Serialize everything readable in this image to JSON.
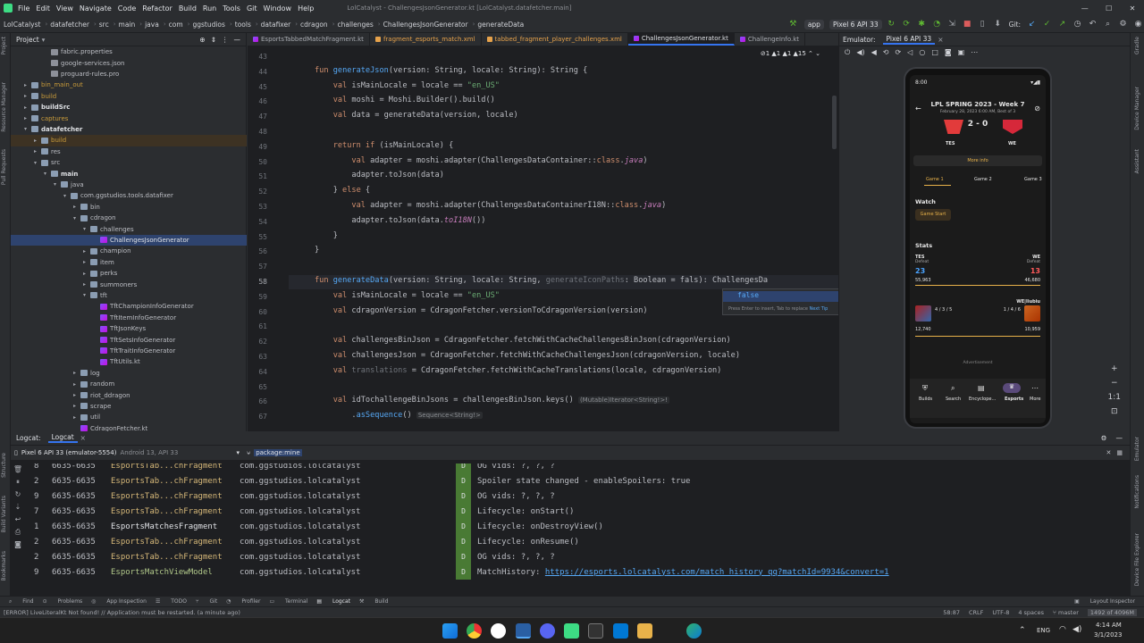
{
  "menu": [
    "File",
    "Edit",
    "View",
    "Navigate",
    "Code",
    "Refactor",
    "Build",
    "Run",
    "Tools",
    "Git",
    "Window",
    "Help"
  ],
  "window_title": "LolCatalyst - ChallengesJsonGenerator.kt [LolCatalyst.datafetcher.main]",
  "breadcrumbs": [
    "LolCatalyst",
    "datafetcher",
    "src",
    "main",
    "java",
    "com",
    "ggstudios",
    "tools",
    "datafixer",
    "cdragon",
    "challenges",
    "ChallengesJsonGenerator",
    "generateData"
  ],
  "toolbar": {
    "run_config": "app",
    "device": "Pixel 6 API 33",
    "git_label": "Git:"
  },
  "project": {
    "title": "Project",
    "rows": [
      {
        "label": "fabric.properties",
        "indent": 3,
        "type": "file",
        "state": ""
      },
      {
        "label": "google-services.json",
        "indent": 3,
        "type": "file",
        "state": ""
      },
      {
        "label": "proguard-rules.pro",
        "indent": 3,
        "type": "file",
        "state": ""
      },
      {
        "label": "bin_main_out",
        "indent": 1,
        "type": "folder",
        "state": "excluded",
        "arrow": "▸"
      },
      {
        "label": "build",
        "indent": 1,
        "type": "folder",
        "state": "excluded",
        "arrow": "▸"
      },
      {
        "label": "buildSrc",
        "indent": 1,
        "type": "folder",
        "state": "bold",
        "arrow": "▸"
      },
      {
        "label": "captures",
        "indent": 1,
        "type": "folder",
        "state": "excluded",
        "arrow": "▸"
      },
      {
        "label": "datafetcher",
        "indent": 1,
        "type": "folder",
        "state": "bold",
        "arrow": "▾"
      },
      {
        "label": "build",
        "indent": 2,
        "type": "folder",
        "state": "excludedbg",
        "arrow": "▸"
      },
      {
        "label": "res",
        "indent": 2,
        "type": "folder",
        "state": "",
        "arrow": "▸"
      },
      {
        "label": "src",
        "indent": 2,
        "type": "folder",
        "state": "",
        "arrow": "▾"
      },
      {
        "label": "main",
        "indent": 3,
        "type": "folder",
        "state": "bold",
        "arrow": "▾"
      },
      {
        "label": "java",
        "indent": 4,
        "type": "folder",
        "state": "",
        "arrow": "▾"
      },
      {
        "label": "com.ggstudios.tools.datafixer",
        "indent": 5,
        "type": "folder",
        "state": "",
        "arrow": "▾"
      },
      {
        "label": "bin",
        "indent": 6,
        "type": "folder",
        "state": "",
        "arrow": "▸"
      },
      {
        "label": "cdragon",
        "indent": 6,
        "type": "folder",
        "state": "",
        "arrow": "▾"
      },
      {
        "label": "challenges",
        "indent": 7,
        "type": "folder",
        "state": "",
        "arrow": "▾"
      },
      {
        "label": "ChallengesJsonGenerator",
        "indent": 8,
        "type": "kt",
        "state": "selected"
      },
      {
        "label": "champion",
        "indent": 7,
        "type": "folder",
        "state": "",
        "arrow": "▸"
      },
      {
        "label": "item",
        "indent": 7,
        "type": "folder",
        "state": "",
        "arrow": "▸"
      },
      {
        "label": "perks",
        "indent": 7,
        "type": "folder",
        "state": "",
        "arrow": "▸"
      },
      {
        "label": "summoners",
        "indent": 7,
        "type": "folder",
        "state": "",
        "arrow": "▸"
      },
      {
        "label": "tft",
        "indent": 7,
        "type": "folder",
        "state": "",
        "arrow": "▾"
      },
      {
        "label": "TftChampionInfoGenerator",
        "indent": 8,
        "type": "kt",
        "state": ""
      },
      {
        "label": "TftItemInfoGenerator",
        "indent": 8,
        "type": "kt",
        "state": ""
      },
      {
        "label": "TftJsonKeys",
        "indent": 8,
        "type": "kt",
        "state": ""
      },
      {
        "label": "TftSetsInfoGenerator",
        "indent": 8,
        "type": "kt",
        "state": ""
      },
      {
        "label": "TftTraitInfoGenerator",
        "indent": 8,
        "type": "kt",
        "state": ""
      },
      {
        "label": "TftUtils.kt",
        "indent": 8,
        "type": "kt",
        "state": ""
      },
      {
        "label": "log",
        "indent": 6,
        "type": "folder",
        "state": "",
        "arrow": "▸"
      },
      {
        "label": "random",
        "indent": 6,
        "type": "folder",
        "state": "",
        "arrow": "▸"
      },
      {
        "label": "riot_ddragon",
        "indent": 6,
        "type": "folder",
        "state": "",
        "arrow": "▸"
      },
      {
        "label": "scrape",
        "indent": 6,
        "type": "folder",
        "state": "",
        "arrow": "▸"
      },
      {
        "label": "util",
        "indent": 6,
        "type": "folder",
        "state": "",
        "arrow": "▸"
      },
      {
        "label": "CdragonFetcher.kt",
        "indent": 6,
        "type": "kt",
        "state": ""
      }
    ]
  },
  "tabs": [
    {
      "label": "EsportsTabbedMatchFragment.kt",
      "icon": "kt",
      "active": false
    },
    {
      "label": "fragment_esports_match.xml",
      "icon": "xml",
      "active": false
    },
    {
      "label": "tabbed_fragment_player_challenges.xml",
      "icon": "xml",
      "active": false
    },
    {
      "label": "ChallengesJsonGenerator.kt",
      "icon": "kt",
      "active": true
    },
    {
      "label": "ChallengeInfo.kt",
      "icon": "kt",
      "active": false
    }
  ],
  "inspections": "⊘1  ▲1  ▲1  ▲15  ⌃ ⌄",
  "code_lines": [
    {
      "n": "43",
      "html": ""
    },
    {
      "n": "44",
      "html": "<span class='kw'>fun</span> <span class='fn'>generateJson</span>(version: String, locale: String): String {"
    },
    {
      "n": "45",
      "html": "    <span class='kw'>val</span> isMainLocale = locale == <span class='str'>\"en_US\"</span>"
    },
    {
      "n": "46",
      "html": "    <span class='kw'>val</span> moshi = Moshi.Builder().build()"
    },
    {
      "n": "47",
      "html": "    <span class='kw'>val</span> data = generateData(version, locale)"
    },
    {
      "n": "48",
      "html": ""
    },
    {
      "n": "49",
      "html": "    <span class='kw'>return if</span> (isMainLocale) {"
    },
    {
      "n": "50",
      "html": "        <span class='kw'>val</span> adapter = moshi.adapter(ChallengesDataContainer::<span class='kw'>class</span>.<span class='it'>java</span>)"
    },
    {
      "n": "51",
      "html": "        adapter.toJson(data)"
    },
    {
      "n": "52",
      "html": "    } <span class='kw'>else</span> {"
    },
    {
      "n": "53",
      "html": "        <span class='kw'>val</span> adapter = moshi.adapter(ChallengesDataContainerI18N::<span class='kw'>class</span>.<span class='it'>java</span>)"
    },
    {
      "n": "54",
      "html": "        adapter.toJson(data.<span class='it'>toI18N</span>())"
    },
    {
      "n": "55",
      "html": "    }"
    },
    {
      "n": "56",
      "html": "}"
    },
    {
      "n": "57",
      "html": ""
    },
    {
      "n": "58",
      "html": "<span class='kw'>fun</span> <span class='fn'>generateData</span>(version: String, locale: String, <span class='gr'>generateIconPaths</span>: Boolean = fals): ChallengesDa"
    },
    {
      "n": "59",
      "html": "    <span class='kw'>val</span> isMainLocale = locale == <span class='str'>\"en_US\"</span>"
    },
    {
      "n": "60",
      "html": "    <span class='kw'>val</span> cdragonVersion = CdragonFetcher.versionToCdragonVersion(version)"
    },
    {
      "n": "61",
      "html": ""
    },
    {
      "n": "62",
      "html": "    <span class='kw'>val</span> challengesBinJson = CdragonFetcher.fetchWithCacheChallengesBinJson(cdragonVersion)"
    },
    {
      "n": "63",
      "html": "    <span class='kw'>val</span> challengesJson = CdragonFetcher.fetchWithCacheChallengesJson(cdragonVersion, locale)"
    },
    {
      "n": "64",
      "html": "    <span class='kw'>val</span> <span class='gr'>translations</span> = CdragonFetcher.fetchWithCacheTranslations(locale, cdragonVersion)"
    },
    {
      "n": "65",
      "html": ""
    },
    {
      "n": "66",
      "html": "    <span class='kw'>val</span> idTochallengeBinJsons = challengesBinJson.keys() <span class='hint'>(Mutable)Iterator&lt;String!&gt;!</span>"
    },
    {
      "n": "67",
      "html": "        .<span class='fn'>asSequence</span>() <span class='hint'>Sequence&lt;String!&gt;</span>"
    }
  ],
  "completion": {
    "option": "false",
    "footer_text": "Press Enter to insert, Tab to replace",
    "next_tip": "Next Tip"
  },
  "emulator": {
    "title": "Emulator:",
    "device": "Pixel 6 API 33",
    "status_time": "8:00",
    "match_title": "LPL SPRING 2023 - Week 7",
    "match_sub": "February 28, 2023 6:00 AM, Best of 3",
    "score": "2 - 0",
    "team1": "TES",
    "team2": "WE",
    "more_info": "More info",
    "games": [
      "Game 1",
      "Game 2",
      "Game 3"
    ],
    "watch": "Watch",
    "game_start": "Game Start",
    "stats": "Stats",
    "t1_result": "Defeat",
    "t2_result": "Defeat",
    "t1_kills": "23",
    "t2_kills": "13",
    "t1_gold": "55,963",
    "t2_gold": "46,680",
    "player_right": "WE|Iiubiu",
    "p1_kda": "4 / 3 / 5",
    "p2_kda": "1 / 4 / 6",
    "p1_gold": "12,740",
    "p2_gold": "10,959",
    "ad": "Advertisement",
    "nav": [
      "Builds",
      "Search",
      "Encyclope...",
      "Esports",
      "More"
    ]
  },
  "logcat": {
    "title": "Logcat:",
    "tab": "Logcat",
    "device": "Pixel 6 API 33 (emulator-5554)",
    "device_sub": "Android 13, API 33",
    "filter": "package:mine",
    "rows": [
      {
        "pid": "6635-6635",
        "tag": "EsportsTab...chFragment",
        "pkg": "com.ggstudios.lolcatalyst",
        "lvl": "D",
        "msg": "OG vids: ?, ?, ?"
      },
      {
        "pid": "6635-6635",
        "tag": "EsportsTab...chFragment",
        "pkg": "com.ggstudios.lolcatalyst",
        "lvl": "D",
        "msg": "Spoiler state changed - enableSpoilers: true"
      },
      {
        "pid": "6635-6635",
        "tag": "EsportsTab...chFragment",
        "pkg": "com.ggstudios.lolcatalyst",
        "lvl": "D",
        "msg": "OG vids: ?, ?, ?"
      },
      {
        "pid": "6635-6635",
        "tag": "EsportsTab...chFragment",
        "pkg": "com.ggstudios.lolcatalyst",
        "lvl": "D",
        "msg": "Lifecycle: onStart()"
      },
      {
        "pid": "6635-6635",
        "tag": "EsportsMatchesFragment",
        "pkg": "com.ggstudios.lolcatalyst",
        "lvl": "D",
        "msg": "Lifecycle: onDestroyView()"
      },
      {
        "pid": "6635-6635",
        "tag": "EsportsTab...chFragment",
        "pkg": "com.ggstudios.lolcatalyst",
        "lvl": "D",
        "msg": "Lifecycle: onResume()"
      },
      {
        "pid": "6635-6635",
        "tag": "EsportsTab...chFragment",
        "pkg": "com.ggstudios.lolcatalyst",
        "lvl": "D",
        "msg": "OG vids: ?, ?, ?"
      },
      {
        "pid": "6635-6635",
        "tag": "EsportsMatchViewModel",
        "pkg": "com.ggstudios.lolcatalyst",
        "lvl": "D",
        "msg": "MatchHistory: ",
        "link": "https://esports.lolcatalyst.com/match_history_qq?matchId=9934&convert=1"
      }
    ],
    "row_nums": [
      "8",
      "2",
      "9",
      "7",
      "1",
      "2",
      "2",
      "9"
    ]
  },
  "bottom_tools": [
    "Find",
    "Problems",
    "App Inspection",
    "TODO",
    "Git",
    "Profiler",
    "Terminal",
    "Logcat",
    "Build"
  ],
  "layout_inspector": "Layout Inspector",
  "status": {
    "message": "[ERROR] LiveLiteralKt Not found! // Application must be restarted. (a minute ago)",
    "pos": "58:87",
    "crlf": "CRLF",
    "enc": "UTF-8",
    "indent": "4 spaces",
    "branch": "master",
    "mem": "1492 of 4096M"
  },
  "taskbar": {
    "lang": "ENG",
    "time": "4:14 AM",
    "date": "3/1/2023"
  }
}
